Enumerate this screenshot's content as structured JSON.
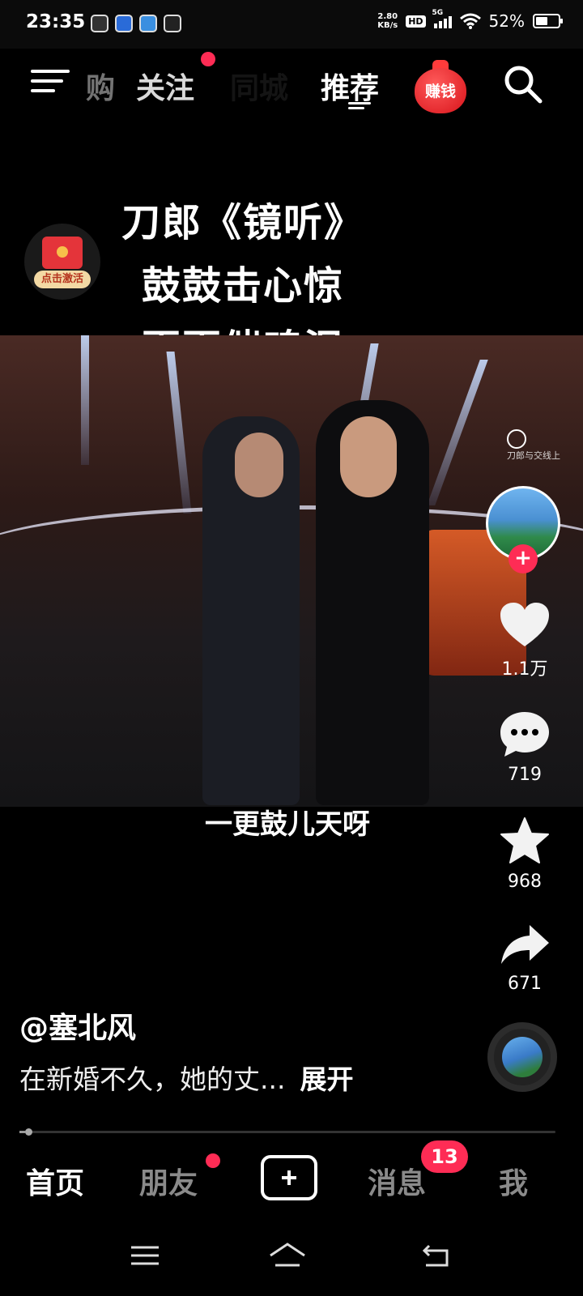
{
  "status_bar": {
    "time": "23:35",
    "net_speed_value": "2.80",
    "net_speed_unit": "KB/s",
    "hd": "HD",
    "network": "5G",
    "battery": "52%",
    "battery_level": 0.52
  },
  "top_nav": {
    "tabs": [
      "购",
      "关注",
      "同城",
      "推荐"
    ],
    "active_tab": "推荐",
    "earn_label": "赚钱"
  },
  "activate_badge": {
    "label": "点击激活"
  },
  "video": {
    "title_lines": [
      "刀郎《镜听》",
      "鼓鼓击心惊",
      "更更催魂泪"
    ],
    "subtitle": "一更鼓儿天呀",
    "watermark": "刀郎与交线上"
  },
  "actions": {
    "likes": "1.1万",
    "comments": "719",
    "favorites": "968",
    "shares": "671"
  },
  "post": {
    "author": "@塞北风",
    "caption": "在新婚不久，她的丈...",
    "expand": "展开"
  },
  "progress": {
    "fraction": 0.01
  },
  "bottom_nav": {
    "home": "首页",
    "friends": "朋友",
    "messages": "消息",
    "messages_badge": "13",
    "me": "我"
  },
  "colors": {
    "accent": "#fe2c55",
    "inactive_text": "#8a8a8a"
  }
}
